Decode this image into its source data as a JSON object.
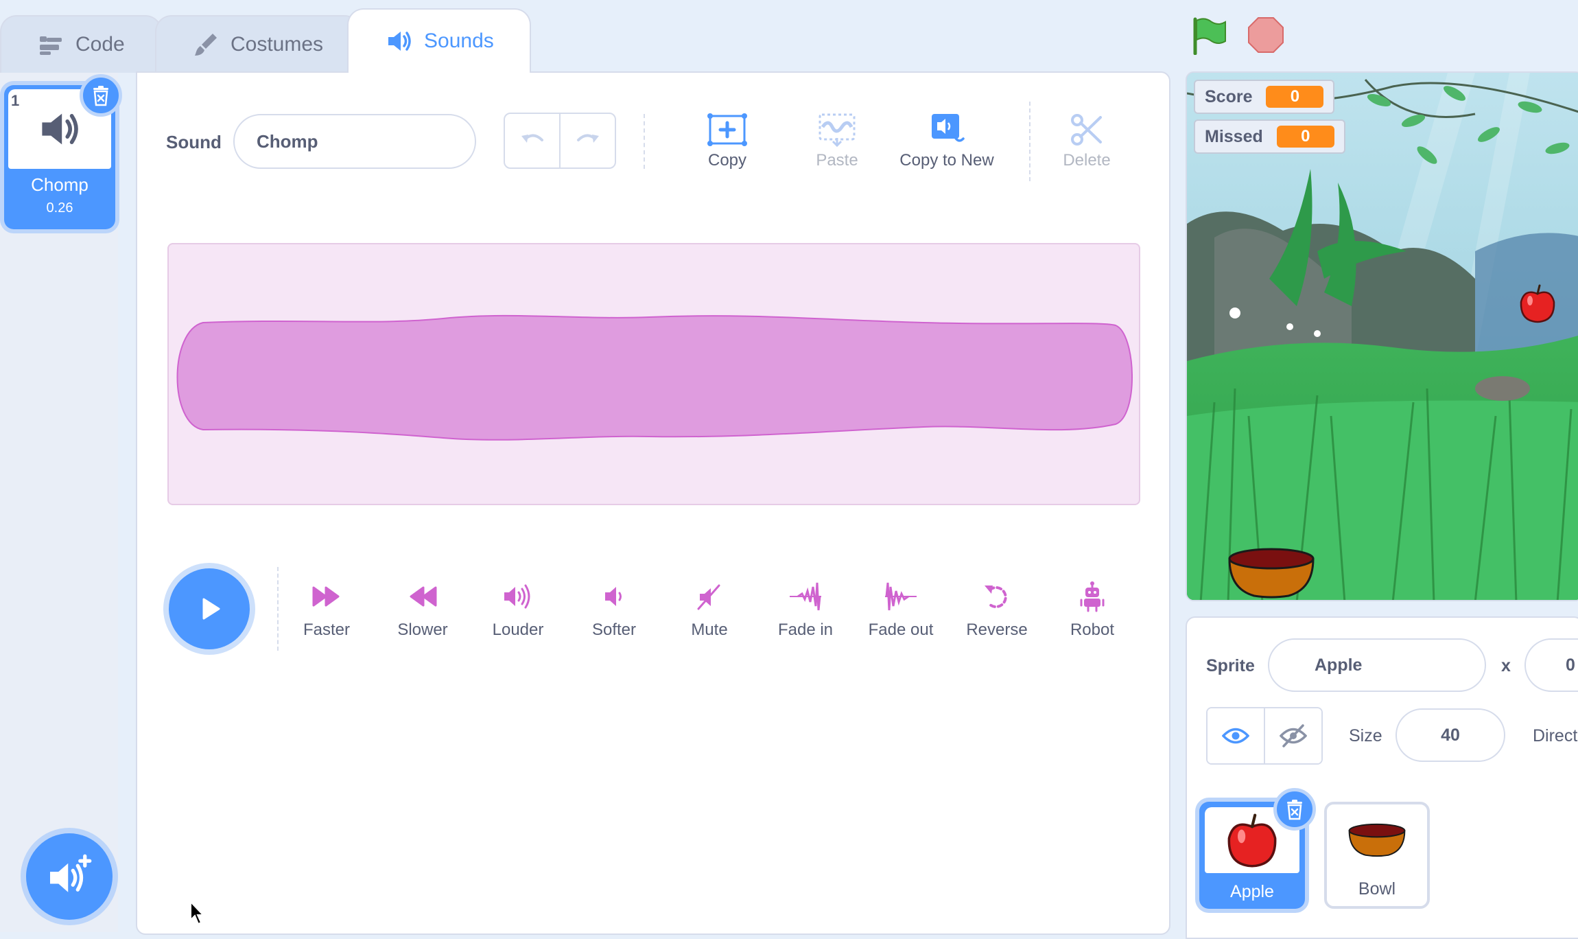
{
  "tabs": [
    {
      "label": "Code",
      "icon": "code-icon"
    },
    {
      "label": "Costumes",
      "icon": "brush-icon"
    },
    {
      "label": "Sounds",
      "icon": "speaker-icon",
      "active": true
    }
  ],
  "sound_list": [
    {
      "index": "1",
      "name": "Chomp",
      "duration": "0.26",
      "selected": true
    }
  ],
  "editor": {
    "sound_label": "Sound",
    "sound_name": "Chomp",
    "tools": {
      "copy": "Copy",
      "paste": "Paste",
      "copy_to_new": "Copy to New",
      "delete": "Delete"
    },
    "effects": [
      "Faster",
      "Slower",
      "Louder",
      "Softer",
      "Mute",
      "Fade in",
      "Fade out",
      "Reverse",
      "Robot"
    ]
  },
  "stage": {
    "monitors": [
      {
        "label": "Score",
        "value": "0"
      },
      {
        "label": "Missed",
        "value": "0"
      }
    ]
  },
  "sprite_info": {
    "sprite_label": "Sprite",
    "sprite_name": "Apple",
    "x_label": "x",
    "x_value": "0",
    "size_label": "Size",
    "size_value": "40",
    "direction_label": "Direct"
  },
  "sprites": [
    {
      "name": "Apple",
      "selected": true
    },
    {
      "name": "Bowl",
      "selected": false
    }
  ],
  "colors": {
    "accent": "#4c97ff",
    "sound": "#cf63cf",
    "monitor": "#ff8c1a",
    "text": "#575e75"
  }
}
